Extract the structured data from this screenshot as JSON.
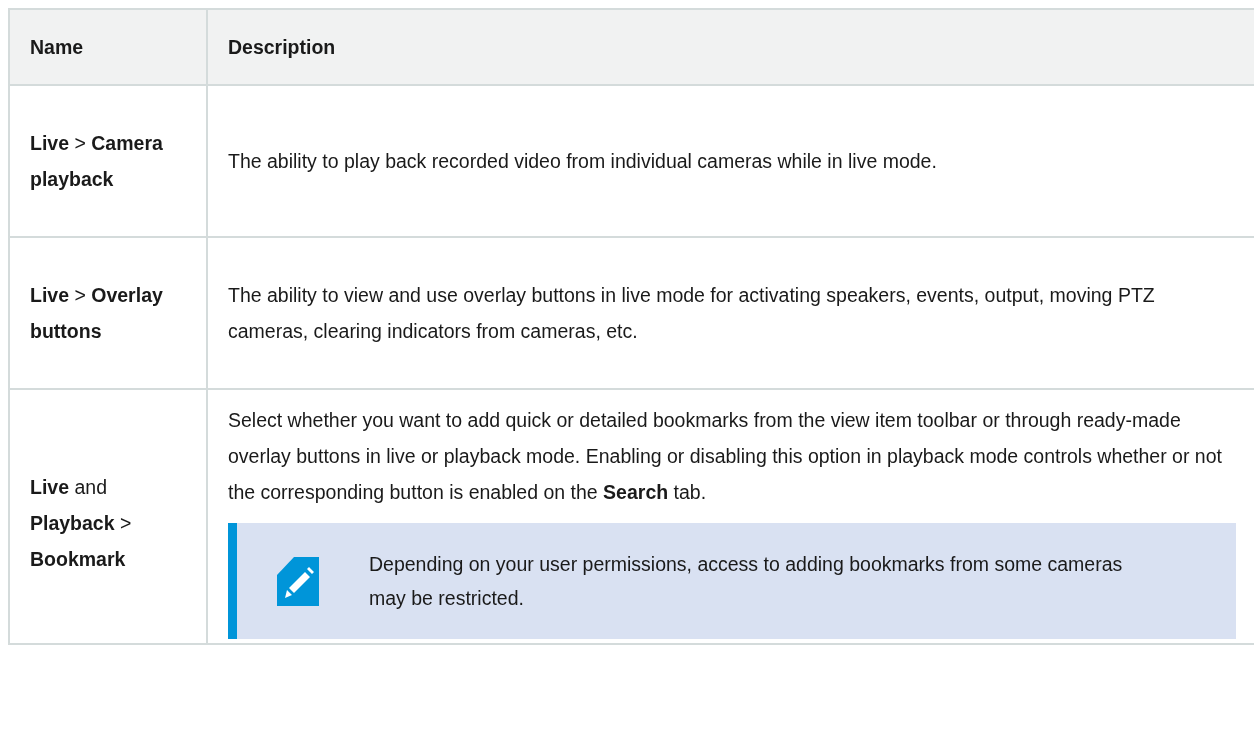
{
  "table": {
    "columns": [
      "Name",
      "Description"
    ],
    "rows": [
      {
        "name": "**Live** > **Camera playback**",
        "description": "The ability to play back recorded video from individual cameras while in live mode."
      },
      {
        "name": "**Live** > **Overlay buttons**",
        "description": "The ability to view and use overlay buttons in live mode for activating speakers, events, output, moving PTZ cameras, clearing indicators from cameras, etc."
      },
      {
        "name": "**Live** and **Playback** > **Bookmark**",
        "description": "Select whether you want to add quick or detailed bookmarks from the view item toolbar or through ready-made overlay buttons in live or playback mode. Enabling or disabling this option in playback mode controls whether or not the corresponding button is enabled on the **Search** tab.",
        "note": "Depending on your user permissions, access to adding bookmarks from some cameras may be restricted."
      }
    ]
  }
}
